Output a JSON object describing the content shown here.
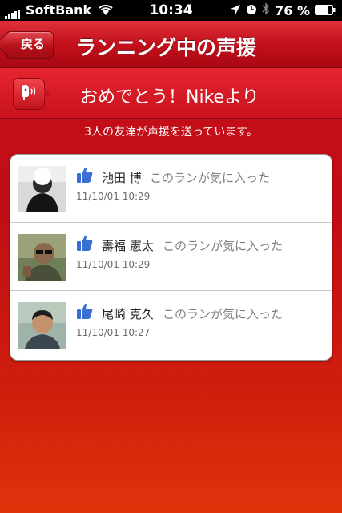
{
  "status": {
    "carrier": "SoftBank",
    "time": "10:34",
    "battery": "76 %"
  },
  "nav": {
    "back_label": "戻る",
    "title": "ランニング中の声援"
  },
  "banner": {
    "message": "おめでとう！Nikeより"
  },
  "subtitle": "3人の友達が声援を送っています。",
  "friends": [
    {
      "name": "池田 博",
      "action": "このランが気に入った",
      "date": "11/10/01  10:29"
    },
    {
      "name": "壽福 憲太",
      "action": "このランが気に入った",
      "date": "11/10/01  10:29"
    },
    {
      "name": "尾崎 克久",
      "action": "このランが気に入った",
      "date": "11/10/01  10:27"
    }
  ],
  "colors": {
    "accent": "#c8101a",
    "like_blue": "#3b6fd3"
  }
}
